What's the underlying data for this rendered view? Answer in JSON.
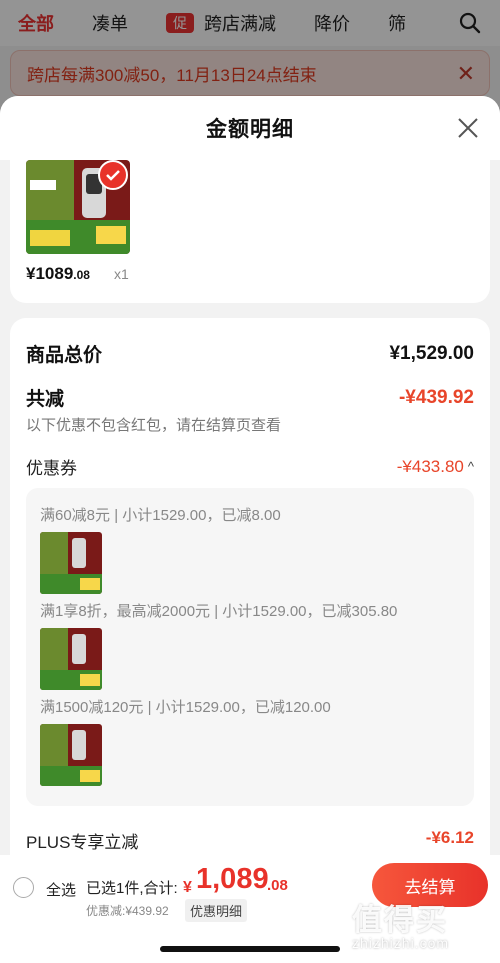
{
  "background": {
    "tabs": [
      "全部",
      "凑单",
      "跨店满减",
      "降价",
      "筛"
    ],
    "kuadian_badge": "促",
    "promo_banner": "跨店每满300减50，11月13日24点结束"
  },
  "sheet": {
    "title": "金额明细",
    "product": {
      "price_main": "¥1089",
      "price_decimal": ".08",
      "quantity": "x1"
    },
    "breakdown": {
      "total_label": "商品总价",
      "total_value": "¥1,529.00",
      "reduction_label": "共减",
      "reduction_value": "-¥439.92",
      "note": "以下优惠不包含红包，请在结算页查看",
      "coupon_label": "优惠券",
      "coupon_value": "-¥433.80",
      "coupon_lines": [
        "满60减8元 | 小计1529.00，已减8.00",
        "满1享8折，最高减2000元 | 小计1529.00，已减305.80",
        "满1500减120元 | 小计1529.00，已减120.00"
      ],
      "plus_label": "PLUS专享立减",
      "plus_value": "-¥6.12"
    }
  },
  "bottom_bar": {
    "select_all": "全选",
    "selected_count": "已选1件,合计:",
    "total_currency": "¥",
    "total_int": "1,089",
    "total_dec": ".08",
    "discount_sum": "优惠减:¥439.92",
    "detail_chip": "优惠明细",
    "checkout": "去结算"
  },
  "watermark": {
    "logo": "值得买",
    "url": "zhizhizhi.com"
  },
  "colors": {
    "accent_red": "#e8452a",
    "brand_red": "#e8322a",
    "overlay": "rgba(0,0,0,0.42)"
  }
}
